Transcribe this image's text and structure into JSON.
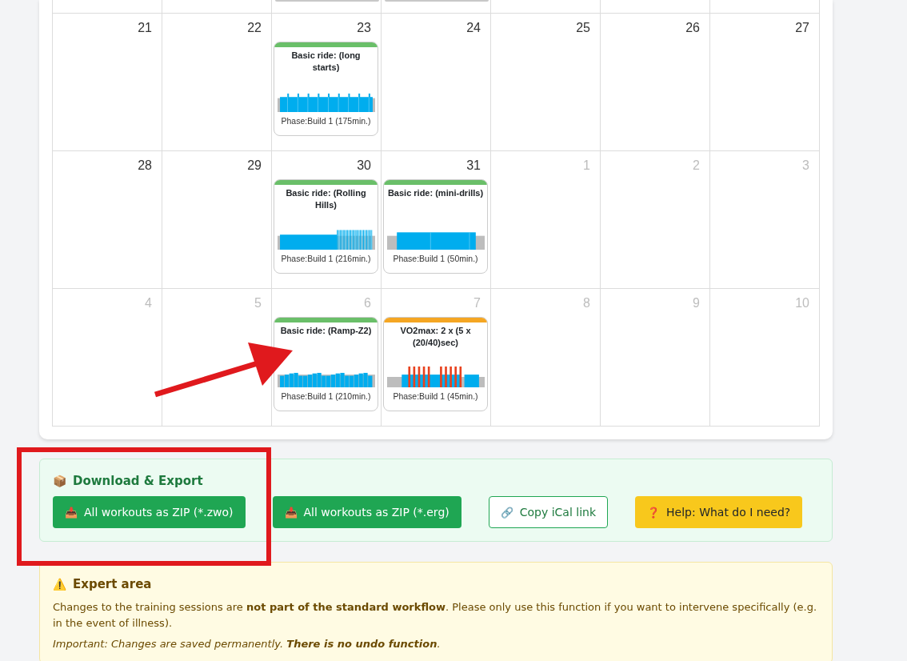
{
  "calendar": {
    "top_row": [
      {
        "cut_workout": false
      },
      {
        "cut_workout": false
      },
      {
        "cut_workout": true
      },
      {
        "cut_workout": true
      },
      {
        "cut_workout": false
      },
      {
        "cut_workout": false
      },
      {
        "cut_workout": false
      }
    ],
    "weeks": [
      {
        "days": [
          {
            "number": "21",
            "outside": false
          },
          {
            "number": "22",
            "outside": false
          },
          {
            "number": "23",
            "outside": false,
            "workout": {
              "title": "Basic ride: (long starts)",
              "phase": "Phase:Build 1 (175min.)",
              "color": "#6abf69",
              "kind": "long_starts"
            }
          },
          {
            "number": "24",
            "outside": false
          },
          {
            "number": "25",
            "outside": false
          },
          {
            "number": "26",
            "outside": false
          },
          {
            "number": "27",
            "outside": false
          }
        ]
      },
      {
        "days": [
          {
            "number": "28",
            "outside": false
          },
          {
            "number": "29",
            "outside": false
          },
          {
            "number": "30",
            "outside": false,
            "workout": {
              "title": "Basic ride: (Rolling Hills)",
              "phase": "Phase:Build 1 (216min.)",
              "color": "#6abf69",
              "kind": "rolling_hills"
            }
          },
          {
            "number": "31",
            "outside": false,
            "workout": {
              "title": "Basic ride: (mini-drills)",
              "phase": "Phase:Build 1 (50min.)",
              "color": "#6abf69",
              "kind": "mini_drills"
            }
          },
          {
            "number": "1",
            "outside": true
          },
          {
            "number": "2",
            "outside": true
          },
          {
            "number": "3",
            "outside": true
          }
        ]
      },
      {
        "days": [
          {
            "number": "4",
            "outside": true
          },
          {
            "number": "5",
            "outside": true
          },
          {
            "number": "6",
            "outside": true,
            "workout": {
              "title": "Basic ride: (Ramp-Z2)",
              "phase": "Phase:Build 1 (210min.)",
              "color": "#6abf69",
              "kind": "ramp"
            }
          },
          {
            "number": "7",
            "outside": true,
            "workout": {
              "title": "VO2max: 2 x (5 x (20/40)sec)",
              "phase": "Phase:Build 1 (45min.)",
              "color": "#f5a623",
              "kind": "vo2max"
            }
          },
          {
            "number": "8",
            "outside": true
          },
          {
            "number": "9",
            "outside": true
          },
          {
            "number": "10",
            "outside": true
          }
        ]
      }
    ]
  },
  "export": {
    "icon": "📦",
    "title": "Download & Export",
    "buttons": [
      {
        "icon": "📥",
        "label": "All workouts as ZIP (*.zwo)",
        "kind": "primary"
      },
      {
        "icon": "📥",
        "label": "All workouts as ZIP (*.erg)",
        "kind": "primary"
      },
      {
        "icon": "🔗",
        "label": "Copy iCal link",
        "kind": "outline"
      },
      {
        "icon": "❓",
        "label": "Help: What do I need?",
        "kind": "warning"
      }
    ]
  },
  "expert": {
    "icon": "⚠️",
    "title": "Expert area",
    "text": "Changes to the training sessions are **not part of the standard workflow**. Please only use this function if you want to intervene specifically (e.g. in the event of illness).",
    "note": "Important: Changes are saved permanently. **There is no undo function**."
  }
}
